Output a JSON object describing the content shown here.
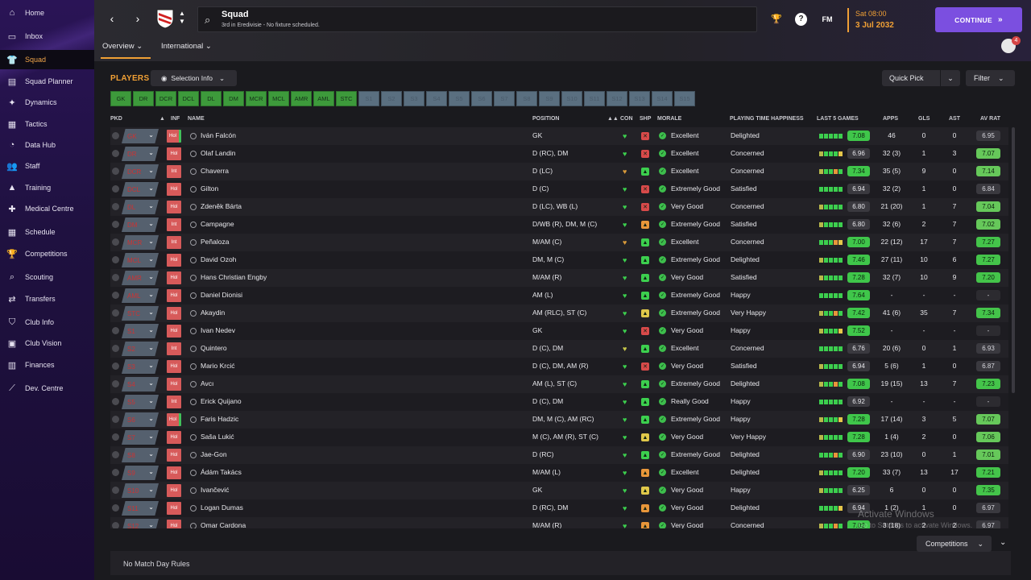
{
  "sidebar": {
    "items": [
      {
        "label": "Home",
        "icon": "home-icon",
        "glyph": "⌂"
      },
      {
        "label": "Inbox",
        "icon": "inbox-icon",
        "glyph": "▭"
      },
      {
        "label": "Squad",
        "icon": "shirt-icon",
        "glyph": "👕"
      },
      {
        "label": "Squad Planner",
        "icon": "planner-icon",
        "glyph": "▤"
      },
      {
        "label": "Dynamics",
        "icon": "dynamics-icon",
        "glyph": "✦"
      },
      {
        "label": "Tactics",
        "icon": "tactics-icon",
        "glyph": "▦"
      },
      {
        "label": "Data Hub",
        "icon": "data-hub-icon",
        "glyph": "◔"
      },
      {
        "label": "Staff",
        "icon": "staff-icon",
        "glyph": "👥"
      },
      {
        "label": "Training",
        "icon": "training-icon",
        "glyph": "▲"
      },
      {
        "label": "Medical Centre",
        "icon": "medical-icon",
        "glyph": "✚"
      },
      {
        "label": "Schedule",
        "icon": "calendar-icon",
        "glyph": "▦"
      },
      {
        "label": "Competitions",
        "icon": "trophy-icon",
        "glyph": "🏆"
      },
      {
        "label": "Scouting",
        "icon": "scouting-icon",
        "glyph": "⌕"
      },
      {
        "label": "Transfers",
        "icon": "transfers-icon",
        "glyph": "⇄"
      },
      {
        "label": "Club Info",
        "icon": "shield-icon",
        "glyph": "⛉"
      },
      {
        "label": "Club Vision",
        "icon": "vision-icon",
        "glyph": "▣"
      },
      {
        "label": "Finances",
        "icon": "finances-icon",
        "glyph": "▥"
      },
      {
        "label": "Dev. Centre",
        "icon": "dev-centre-icon",
        "glyph": "⟋"
      }
    ]
  },
  "topbar": {
    "title": "Squad",
    "subtitle": "3rd in Eredivisie - No fixture scheduled.",
    "help": "?",
    "fm": "FM",
    "date_time": "Sat 08:00",
    "date_day": "3 Jul 2032",
    "continue_label": "CONTINUE",
    "tab_overview": "Overview",
    "tab_international": "International",
    "notifications": "4"
  },
  "main": {
    "players_title": "PLAYERS",
    "selection_info": "Selection Info",
    "quick_pick": "Quick Pick",
    "filter": "Filter",
    "position_buttons": [
      {
        "label": "GK",
        "filled": true
      },
      {
        "label": "DR",
        "filled": true
      },
      {
        "label": "DCR",
        "filled": true
      },
      {
        "label": "DCL",
        "filled": true
      },
      {
        "label": "DL",
        "filled": true
      },
      {
        "label": "DM",
        "filled": true
      },
      {
        "label": "MCR",
        "filled": true
      },
      {
        "label": "MCL",
        "filled": true
      },
      {
        "label": "AMR",
        "filled": true
      },
      {
        "label": "AML",
        "filled": true
      },
      {
        "label": "STC",
        "filled": true
      },
      {
        "label": "S1",
        "filled": false
      },
      {
        "label": "S2",
        "filled": false
      },
      {
        "label": "S3",
        "filled": false
      },
      {
        "label": "S4",
        "filled": false
      },
      {
        "label": "S5",
        "filled": false
      },
      {
        "label": "S6",
        "filled": false
      },
      {
        "label": "S7",
        "filled": false
      },
      {
        "label": "S8",
        "filled": false
      },
      {
        "label": "S9",
        "filled": false
      },
      {
        "label": "S10",
        "filled": false
      },
      {
        "label": "S11",
        "filled": false
      },
      {
        "label": "S12",
        "filled": false
      },
      {
        "label": "S13",
        "filled": false
      },
      {
        "label": "S14",
        "filled": false
      },
      {
        "label": "S15",
        "filled": false
      }
    ],
    "headers": {
      "pkd": "PKD",
      "inf": "INF",
      "name": "NAME",
      "position": "POSITION",
      "con": "CON",
      "shp": "SHP",
      "morale": "MORALE",
      "happiness": "PLAYING TIME HAPPINESS",
      "last5": "LAST 5 GAMES",
      "apps": "APPS",
      "gls": "GLS",
      "ast": "AST",
      "avrat": "AV RAT"
    },
    "players": [
      {
        "pkd": "GK",
        "inf": "Hol",
        "name": "Iván Falcón",
        "position": "GK",
        "morale": "Excellent",
        "happiness": "Delighted",
        "form_rating": "7.08",
        "apps": "46",
        "gls": "0",
        "ast": "0",
        "av_rat": "6.95"
      },
      {
        "pkd": "DR",
        "inf": "Hol",
        "name": "Olaf Landin",
        "position": "D (RC), DM",
        "morale": "Excellent",
        "happiness": "Concerned",
        "form_rating": "6.96",
        "apps": "32 (3)",
        "gls": "1",
        "ast": "3",
        "av_rat": "7.07"
      },
      {
        "pkd": "DCR",
        "inf": "Int",
        "name": "Chaverra",
        "position": "D (LC)",
        "morale": "Excellent",
        "happiness": "Concerned",
        "form_rating": "7.34",
        "apps": "35 (5)",
        "gls": "9",
        "ast": "0",
        "av_rat": "7.14"
      },
      {
        "pkd": "DCL",
        "inf": "Hol",
        "name": "Gilton",
        "position": "D (C)",
        "morale": "Extremely Good",
        "happiness": "Satisfied",
        "form_rating": "6.94",
        "apps": "32 (2)",
        "gls": "1",
        "ast": "0",
        "av_rat": "6.84"
      },
      {
        "pkd": "DL",
        "inf": "Hol",
        "name": "Zdeněk Bárta",
        "position": "D (LC), WB (L)",
        "morale": "Very Good",
        "happiness": "Concerned",
        "form_rating": "6.80",
        "apps": "21 (20)",
        "gls": "1",
        "ast": "7",
        "av_rat": "7.04"
      },
      {
        "pkd": "DM",
        "inf": "Int",
        "name": "Campagne",
        "position": "D/WB (R), DM, M (C)",
        "morale": "Extremely Good",
        "happiness": "Satisfied",
        "form_rating": "6.80",
        "apps": "32 (6)",
        "gls": "2",
        "ast": "7",
        "av_rat": "7.02"
      },
      {
        "pkd": "MCR",
        "inf": "Int",
        "name": "Peñaloza",
        "position": "M/AM (C)",
        "morale": "Excellent",
        "happiness": "Concerned",
        "form_rating": "7.00",
        "apps": "22 (12)",
        "gls": "17",
        "ast": "7",
        "av_rat": "7.27"
      },
      {
        "pkd": "MCL",
        "inf": "Hol",
        "name": "David Ozoh",
        "position": "DM, M (C)",
        "morale": "Extremely Good",
        "happiness": "Delighted",
        "form_rating": "7.46",
        "apps": "27 (11)",
        "gls": "10",
        "ast": "6",
        "av_rat": "7.27"
      },
      {
        "pkd": "AMR",
        "inf": "Hol",
        "name": "Hans Christian Engby",
        "position": "M/AM (R)",
        "morale": "Very Good",
        "happiness": "Satisfied",
        "form_rating": "7.28",
        "apps": "32 (7)",
        "gls": "10",
        "ast": "9",
        "av_rat": "7.20"
      },
      {
        "pkd": "AML",
        "inf": "Hol",
        "name": "Daniel Dionisi",
        "position": "AM (L)",
        "morale": "Extremely Good",
        "happiness": "Happy",
        "form_rating": "7.64",
        "apps": "-",
        "gls": "-",
        "ast": "-",
        "av_rat": "-"
      },
      {
        "pkd": "STC",
        "inf": "Hol",
        "name": "Akaydin",
        "position": "AM (RLC), ST (C)",
        "morale": "Extremely Good",
        "happiness": "Very Happy",
        "form_rating": "7.42",
        "apps": "41 (6)",
        "gls": "35",
        "ast": "7",
        "av_rat": "7.34"
      },
      {
        "pkd": "S1",
        "inf": "Hol",
        "name": "Ivan Nedev",
        "position": "GK",
        "morale": "Very Good",
        "happiness": "Happy",
        "form_rating": "7.52",
        "apps": "-",
        "gls": "-",
        "ast": "-",
        "av_rat": "-"
      },
      {
        "pkd": "S2",
        "inf": "Int",
        "name": "Quintero",
        "position": "D (C), DM",
        "morale": "Excellent",
        "happiness": "Concerned",
        "form_rating": "6.76",
        "apps": "20 (6)",
        "gls": "0",
        "ast": "1",
        "av_rat": "6.93"
      },
      {
        "pkd": "S3",
        "inf": "Hol",
        "name": "Mario Krcić",
        "position": "D (C), DM, AM (R)",
        "morale": "Very Good",
        "happiness": "Satisfied",
        "form_rating": "6.94",
        "apps": "5 (6)",
        "gls": "1",
        "ast": "0",
        "av_rat": "6.87"
      },
      {
        "pkd": "S4",
        "inf": "Hol",
        "name": "Avcı",
        "position": "AM (L), ST (C)",
        "morale": "Extremely Good",
        "happiness": "Delighted",
        "form_rating": "7.08",
        "apps": "19 (15)",
        "gls": "13",
        "ast": "7",
        "av_rat": "7.23"
      },
      {
        "pkd": "S5",
        "inf": "Int",
        "name": "Erick Quijano",
        "position": "D (C), DM",
        "morale": "Really Good",
        "happiness": "Happy",
        "form_rating": "6.92",
        "apps": "-",
        "gls": "-",
        "ast": "-",
        "av_rat": "-"
      },
      {
        "pkd": "S6",
        "inf": "Hol",
        "name": "Faris Hadzic",
        "position": "DM, M (C), AM (RC)",
        "morale": "Extremely Good",
        "happiness": "Happy",
        "form_rating": "7.28",
        "apps": "17 (14)",
        "gls": "3",
        "ast": "5",
        "av_rat": "7.07"
      },
      {
        "pkd": "S7",
        "inf": "Hol",
        "name": "Saša Lukić",
        "position": "M (C), AM (R), ST (C)",
        "morale": "Very Good",
        "happiness": "Very Happy",
        "form_rating": "7.28",
        "apps": "1 (4)",
        "gls": "2",
        "ast": "0",
        "av_rat": "7.06"
      },
      {
        "pkd": "S8",
        "inf": "Hol",
        "name": "Jae-Gon",
        "position": "D (RC)",
        "morale": "Extremely Good",
        "happiness": "Delighted",
        "form_rating": "6.90",
        "apps": "23 (10)",
        "gls": "0",
        "ast": "1",
        "av_rat": "7.01"
      },
      {
        "pkd": "S9",
        "inf": "Hol",
        "name": "Ádám Takács",
        "position": "M/AM (L)",
        "morale": "Excellent",
        "happiness": "Delighted",
        "form_rating": "7.20",
        "apps": "33 (7)",
        "gls": "13",
        "ast": "17",
        "av_rat": "7.21"
      },
      {
        "pkd": "S10",
        "inf": "Hol",
        "name": "Ivančević",
        "position": "GK",
        "morale": "Very Good",
        "happiness": "Happy",
        "form_rating": "6.25",
        "apps": "6",
        "gls": "0",
        "ast": "0",
        "av_rat": "7.35"
      },
      {
        "pkd": "S11",
        "inf": "Hol",
        "name": "Logan Dumas",
        "position": "D (RC), DM",
        "morale": "Very Good",
        "happiness": "Delighted",
        "form_rating": "6.94",
        "apps": "1 (2)",
        "gls": "1",
        "ast": "0",
        "av_rat": "6.97"
      },
      {
        "pkd": "S12",
        "inf": "Hol",
        "name": "Omar Cardona",
        "position": "M/AM (R)",
        "morale": "Very Good",
        "happiness": "Concerned",
        "form_rating": "7.02",
        "apps": "3 (18)",
        "gls": "2",
        "ast": "2",
        "av_rat": "6.97"
      }
    ],
    "footer_text": "No Match Day Rules",
    "competitions": "Competitions",
    "watermark_title": "Activate Windows",
    "watermark_sub": "Go to Settings to activate Windows."
  }
}
